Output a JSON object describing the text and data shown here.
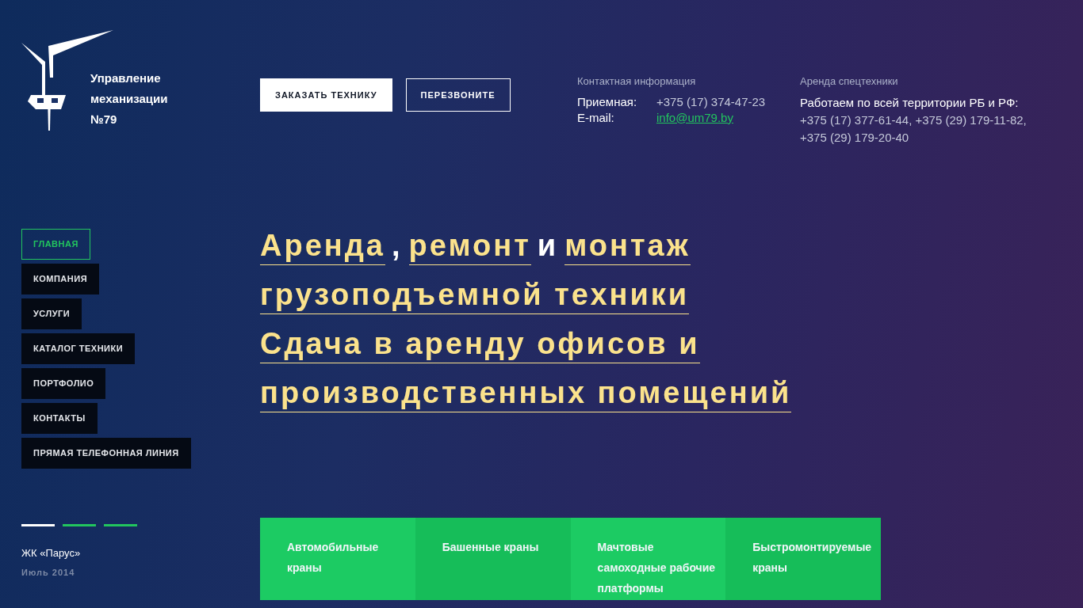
{
  "company": {
    "name_lines": [
      "Управление",
      "механизации",
      "№79"
    ]
  },
  "header_buttons": [
    {
      "label": "ЗАКАЗАТЬ ТЕХНИКУ",
      "kind": "filled"
    },
    {
      "label": "ПЕРЕЗВОНИТЕ",
      "kind": "outline"
    }
  ],
  "contact_info": {
    "title": "Контактная информация",
    "rows": [
      {
        "label": "Приемная:",
        "value": "+375 (17) 374-47-23",
        "kind": "text"
      },
      {
        "label": "E-mail:",
        "value": "info@um79.by",
        "kind": "link"
      }
    ]
  },
  "rental": {
    "title": "Аренда спецтехники",
    "lead": "Работаем по всей территории РБ и РФ:",
    "phones": [
      "+375 (17) 377-61-44, +375 (29) 179-11-82,",
      "+375 (29) 179-20-40"
    ]
  },
  "nav": [
    {
      "label": "ГЛАВНАЯ",
      "selected": true
    },
    {
      "label": "КОМПАНИЯ",
      "selected": false
    },
    {
      "label": "УСЛУГИ",
      "selected": false
    },
    {
      "label": "КАТАЛОГ ТЕХНИКИ",
      "selected": false
    },
    {
      "label": "ПОРТФОЛИО",
      "selected": false
    },
    {
      "label": "КОНТАКТЫ",
      "selected": false
    },
    {
      "label": "ПРЯМАЯ ТЕЛЕФОННАЯ ЛИНИЯ",
      "selected": false
    }
  ],
  "slides": [
    {
      "selected": true
    },
    {
      "selected": false
    },
    {
      "selected": false
    }
  ],
  "slide_caption": {
    "title": "ЖК «Парус»",
    "date": "Июль 2014"
  },
  "headline": [
    [
      {
        "text": "Аренда",
        "highlighted": true
      },
      {
        "text": ",",
        "highlighted": false
      },
      {
        "text": "ремонт",
        "highlighted": true
      },
      {
        "text": "и",
        "highlighted": false
      },
      {
        "text": "монтаж",
        "highlighted": true
      }
    ],
    [
      {
        "text": "грузоподъемной техники",
        "highlighted": true
      }
    ],
    [
      {
        "text": "Сдача в аренду офисов и",
        "highlighted": true
      }
    ],
    [
      {
        "text": "производственных помещений",
        "highlighted": true
      }
    ]
  ],
  "service_cards": [
    {
      "label": "Автомобильные краны"
    },
    {
      "label": "Башенные краны"
    },
    {
      "label": "Мачтовые самоходные рабочие платформы"
    },
    {
      "label": "Быстромонтируемые краны"
    }
  ]
}
